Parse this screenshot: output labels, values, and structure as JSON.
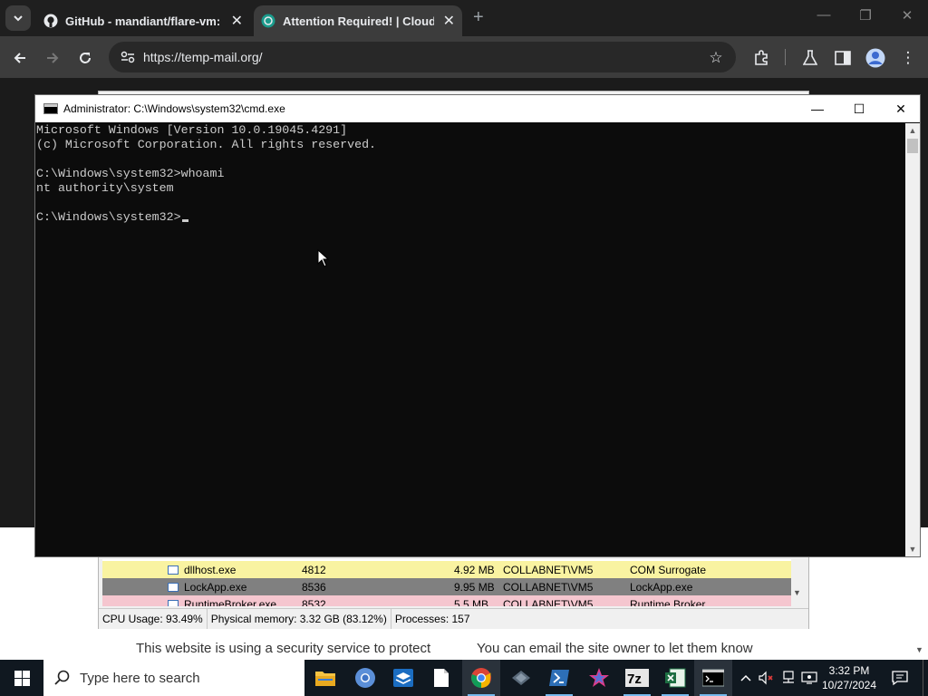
{
  "browser": {
    "tabs": [
      {
        "label": "GitHub - mandiant/flare-vm: A",
        "icon": "github-icon",
        "active": false
      },
      {
        "label": "Attention Required! | Cloudflare",
        "icon": "cloudflare-icon",
        "active": true
      }
    ],
    "new_tab_label": "+",
    "url": "https://temp-mail.org/"
  },
  "page": {
    "text_left": "This website is using a security service to protect",
    "text_right": "You can email the site owner to let them know"
  },
  "process_explorer": {
    "rows": [
      {
        "name": "dllhost.exe",
        "pid": "4812",
        "memory": "4.92 MB",
        "user": "COLLABNET\\VM5",
        "description": "COM Surrogate",
        "color": "#f9f3a1"
      },
      {
        "name": "LockApp.exe",
        "pid": "8536",
        "memory": "9.95 MB",
        "user": "COLLABNET\\VM5",
        "description": "LockApp.exe",
        "color": "#808080"
      },
      {
        "name": "RuntimeBroker.exe",
        "pid": "8532",
        "memory": "5.5 MB",
        "user": "COLLABNET\\VM5",
        "description": "Runtime Broker",
        "color": "#f5c6cf"
      }
    ],
    "status": {
      "cpu": "CPU Usage: 93.49%",
      "memory": "Physical memory: 3.32 GB (83.12%)",
      "processes": "Processes: 157"
    }
  },
  "cmd": {
    "title": "Administrator: C:\\Windows\\system32\\cmd.exe",
    "lines": [
      "Microsoft Windows [Version 10.0.19045.4291]",
      "(c) Microsoft Corporation. All rights reserved.",
      "",
      "C:\\Windows\\system32>whoami",
      "nt authority\\system",
      "",
      "C:\\Windows\\system32>"
    ]
  },
  "taskbar": {
    "search_placeholder": "Type here to search",
    "time": "3:32 PM",
    "date": "10/27/2024",
    "apps": [
      "file-explorer-icon",
      "chromium-icon",
      "virtualbox-icon",
      "notepad-icon",
      "chrome-icon",
      "ida-icon",
      "powershell-icon",
      "visual-studio-icon",
      "7zip-icon",
      "excel-icon",
      "cmd-icon"
    ]
  }
}
